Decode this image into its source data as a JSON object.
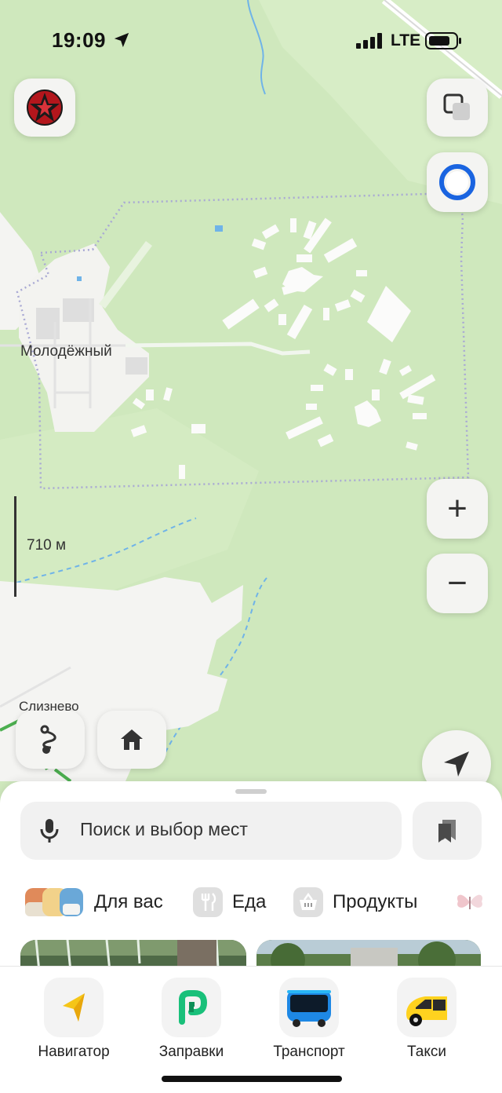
{
  "status_bar": {
    "time": "19:09",
    "network": "LTE"
  },
  "map": {
    "places": [
      {
        "name": "Молодёжный"
      },
      {
        "name": "Слизнево"
      }
    ],
    "scale_label": "710 м"
  },
  "map_buttons": {
    "profile": "profile-avatar",
    "layers": "layers-icon",
    "alice": "alice-icon",
    "zoom_in": "+",
    "zoom_out": "−",
    "route": "route-icon",
    "home": "home-icon",
    "location": "location-arrow-icon"
  },
  "search": {
    "placeholder": "Поиск и выбор мест"
  },
  "categories": [
    {
      "label": "Для вас",
      "icon": "for-you-icon"
    },
    {
      "label": "Еда",
      "icon": "fork-knife-icon"
    },
    {
      "label": "Продукты",
      "icon": "basket-icon"
    }
  ],
  "dock": [
    {
      "label": "Навигатор",
      "icon": "navigator-icon"
    },
    {
      "label": "Заправки",
      "icon": "fuel-icon"
    },
    {
      "label": "Транспорт",
      "icon": "bus-icon"
    },
    {
      "label": "Такси",
      "icon": "taxi-icon"
    }
  ],
  "colors": {
    "map_green": "#cfe8bd",
    "map_white": "#f5f5f3",
    "boundary": "#a9a9d4",
    "water": "#6fb3e8",
    "road": "#4caf50",
    "alice": "#1a64e0",
    "fuel": "#19c07a",
    "taxi": "#ffd21f"
  }
}
